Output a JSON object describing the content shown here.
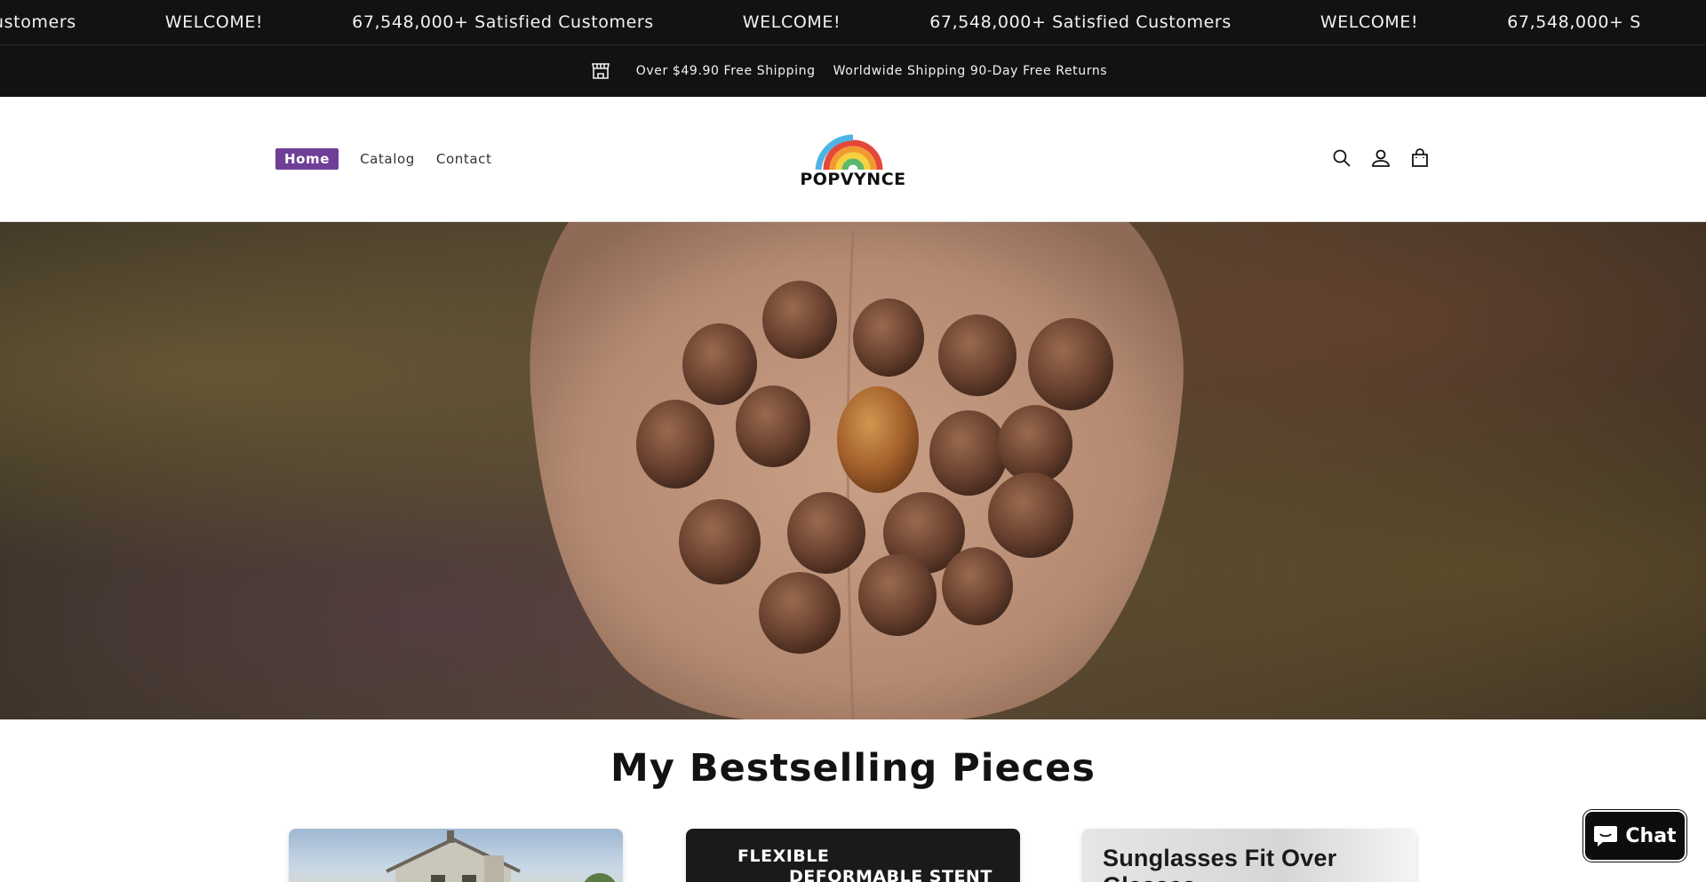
{
  "marquee": {
    "items": [
      "ustomers",
      "WELCOME!",
      "67,548,000+ Satisfied Customers",
      "WELCOME!",
      "67,548,000+ Satisfied Customers",
      "WELCOME!",
      "67,548,000+ S"
    ]
  },
  "shipping": {
    "left_text": "Over $49.90 Free Shipping",
    "right_text": "Worldwide Shipping 90-Day Free Returns",
    "icon": "store-icon"
  },
  "header": {
    "nav": [
      {
        "label": "Home",
        "active": true
      },
      {
        "label": "Catalog",
        "active": false
      },
      {
        "label": "Contact",
        "active": false
      }
    ],
    "logo_text": "POPVYNCE",
    "icons": [
      "search-icon",
      "account-icon",
      "cart-icon"
    ]
  },
  "hero": {
    "image_alt": "hands holding acorns"
  },
  "section": {
    "title": "My Bestselling Pieces"
  },
  "products": [
    {
      "image": "house"
    },
    {
      "image_text_line1": "FLEXIBLE",
      "image_text_line2": "DEFORMABLE STENT"
    },
    {
      "image_text": "Sunglasses Fit Over Glasses"
    }
  ],
  "chat": {
    "label": "Chat"
  },
  "colors": {
    "topbar_bg": "#121212",
    "nav_active_bg": "#6f3e96",
    "logo_rainbow": [
      "#e5473b",
      "#f29a32",
      "#f7d23e",
      "#5db86a",
      "#4fb3e3"
    ]
  }
}
